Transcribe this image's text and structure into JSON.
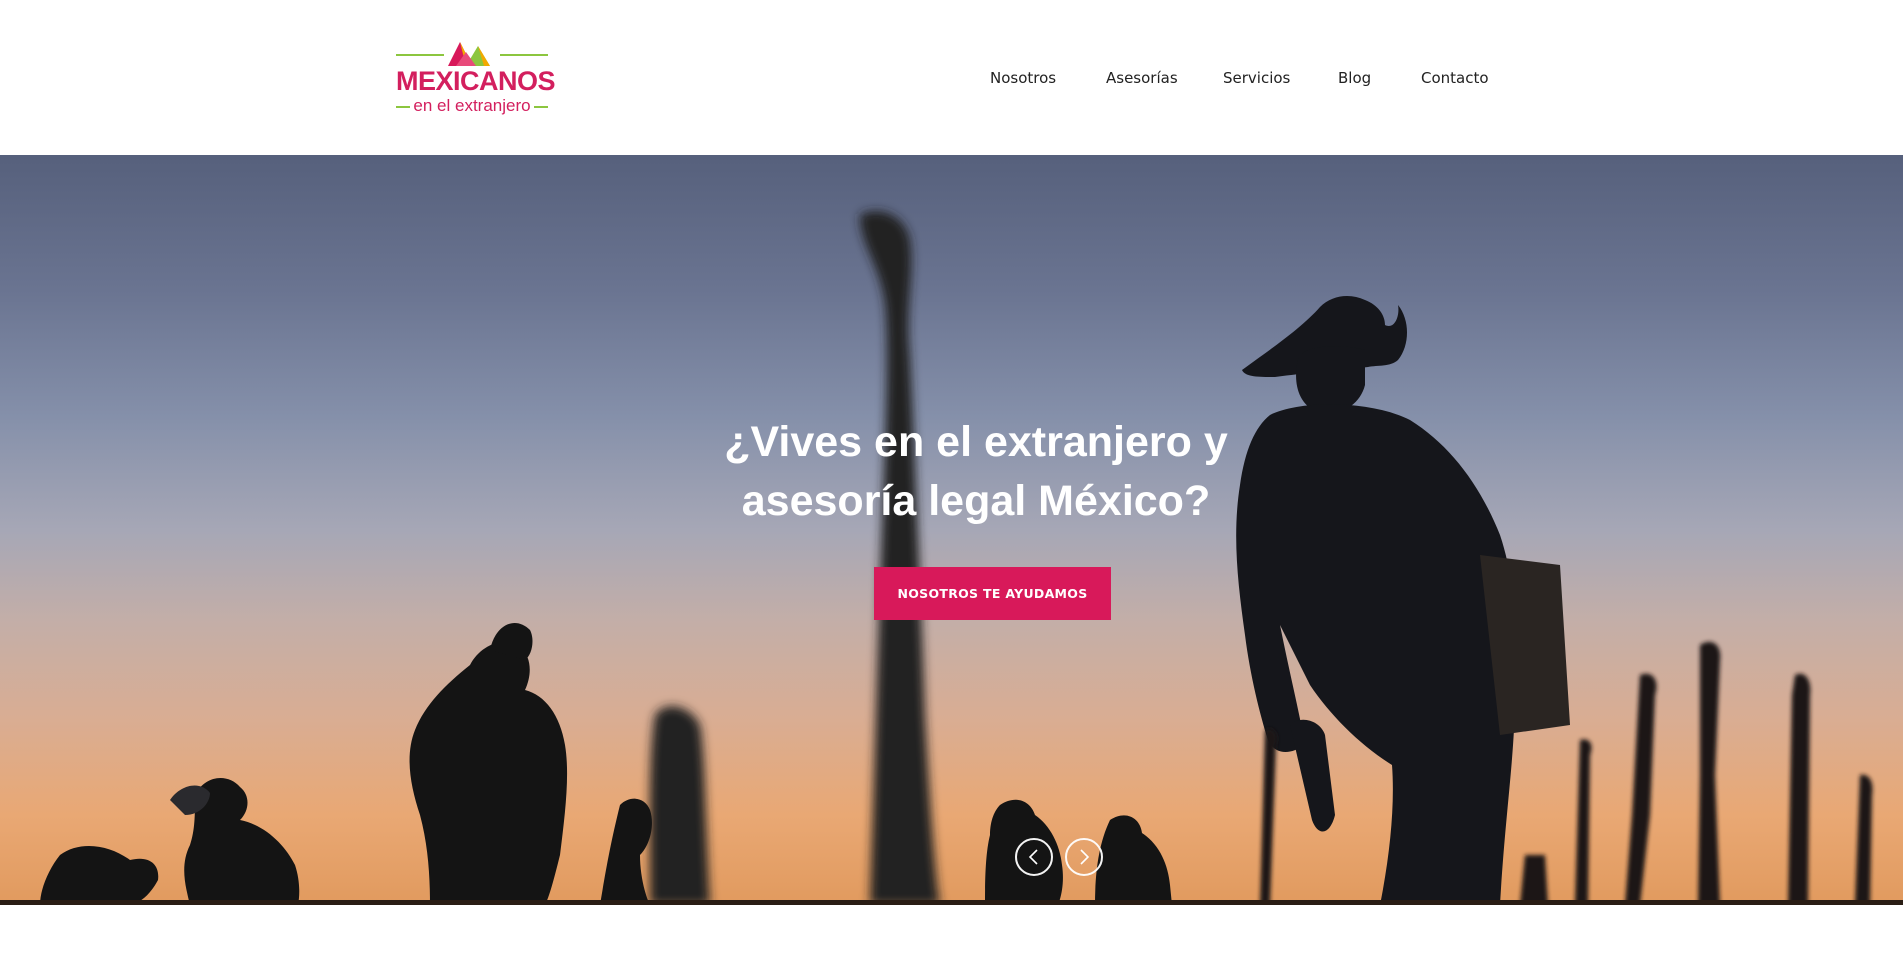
{
  "brand": {
    "name": "MEXICANOS",
    "tagline": "en el extranjero",
    "primary_color": "#d8195a",
    "accent_color": "#8cc63f",
    "logo_icon": "mountain-mark-icon"
  },
  "nav": {
    "items": [
      {
        "label": "Nosotros"
      },
      {
        "label": "Asesorías"
      },
      {
        "label": "Servicios"
      },
      {
        "label": "Blog"
      },
      {
        "label": "Contacto"
      }
    ]
  },
  "hero": {
    "title_line1": "¿Vives en el extranjero y",
    "title_line2": "asesoría legal México?",
    "cta_label": "NOSOTROS TE AYUDAMOS",
    "background": "silhouettes-at-sunset-photo",
    "prev_icon": "chevron-left-icon",
    "next_icon": "chevron-right-icon"
  }
}
